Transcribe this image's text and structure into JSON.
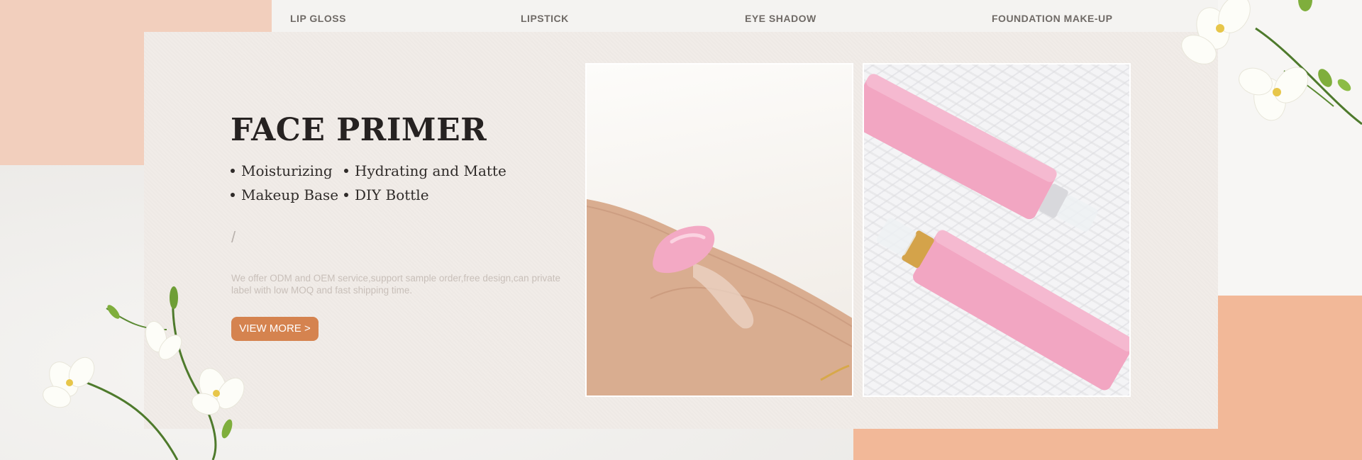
{
  "nav": {
    "items": [
      {
        "label": "LIP GLOSS"
      },
      {
        "label": "LIPSTICK"
      },
      {
        "label": "EYE SHADOW"
      },
      {
        "label": "FOUNDATION MAKE-UP"
      }
    ]
  },
  "hero": {
    "title": "FACE PRIMER",
    "features": [
      "Moisturizing",
      "Hydrating and Matte",
      "Makeup Base",
      "DIY Bottle"
    ],
    "divider": "/",
    "description": "We offer ODM and OEM service,support sample order,free design,can private label with low MOQ and fast shipping time.",
    "button_label": "VIEW MORE >"
  },
  "colors": {
    "accent": "#d5834f",
    "peach": "#f2b898",
    "peach_light": "#f2cfbd",
    "card": "#f1ece8",
    "product_pink": "#f3a9c4"
  },
  "icons": [
    "flower-decoration"
  ]
}
